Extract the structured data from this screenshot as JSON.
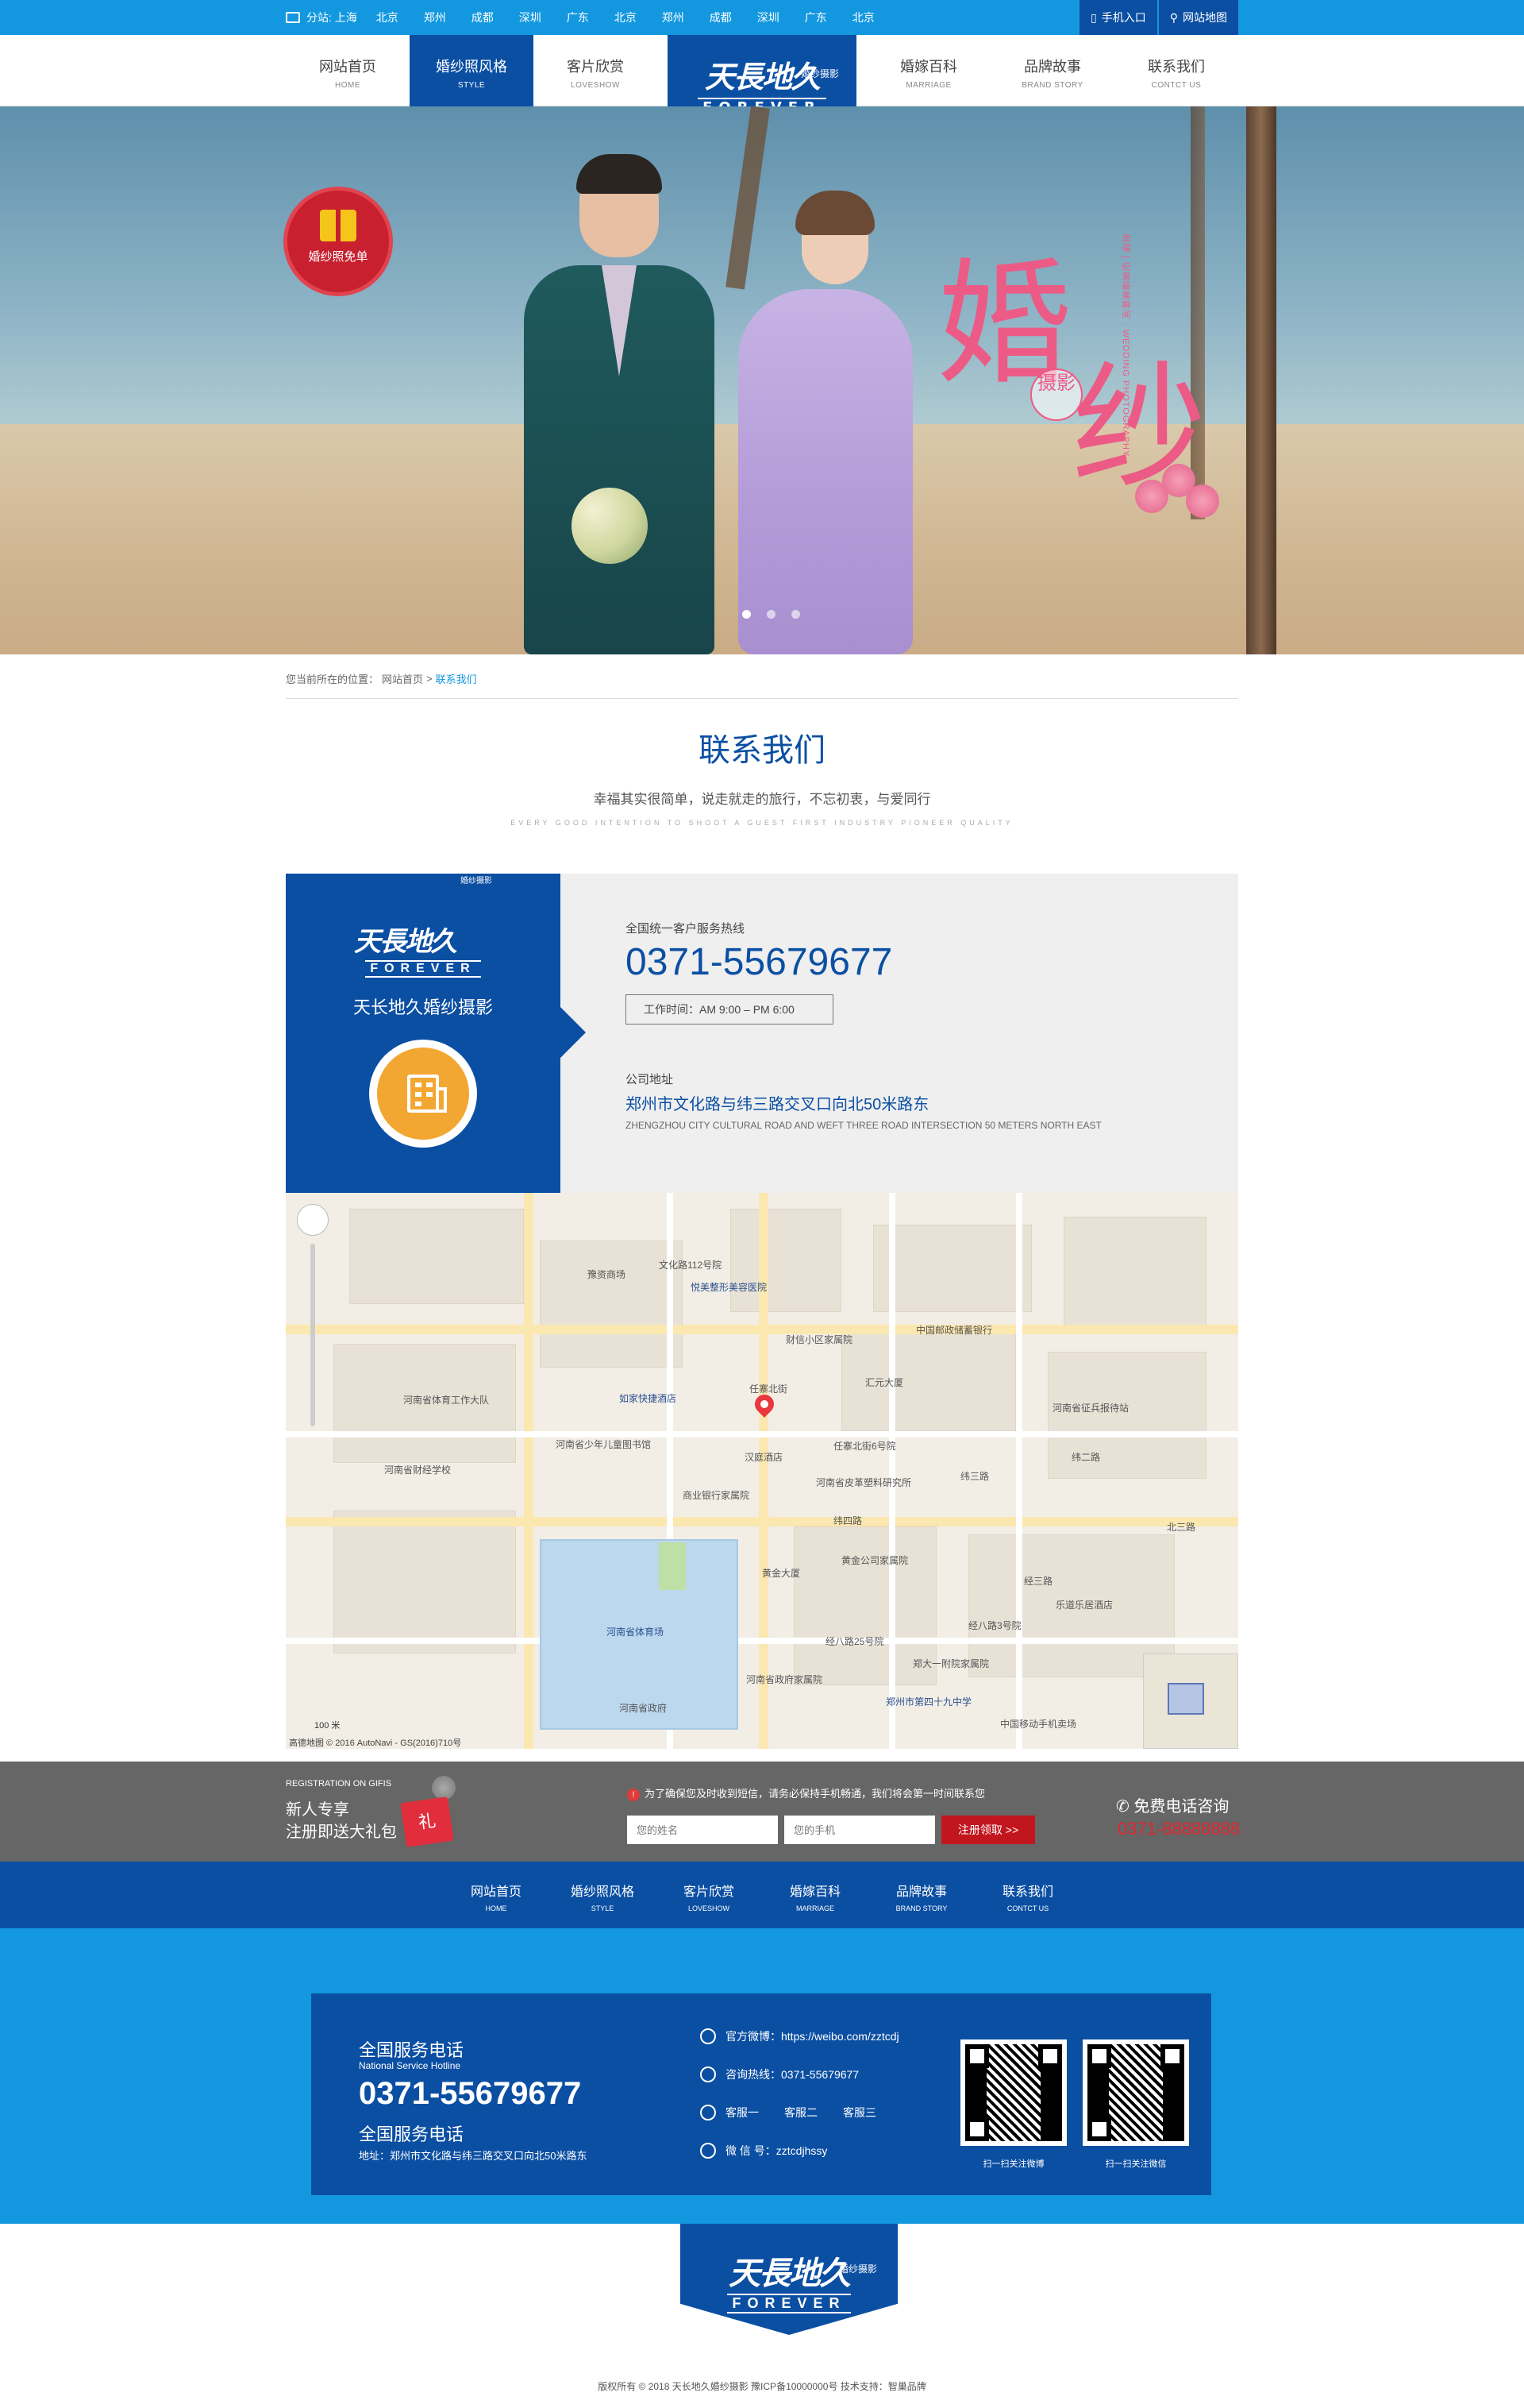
{
  "topbar": {
    "location_label": "分站: 上海",
    "cities": [
      "北京",
      "郑州",
      "成都",
      "深圳",
      "广东",
      "北京",
      "郑州",
      "成都",
      "深圳",
      "广东",
      "北京"
    ],
    "mobile_label": "手机入口",
    "sitemap_label": "网站地图"
  },
  "nav": {
    "items": [
      {
        "cn": "网站首页",
        "en": "HOME"
      },
      {
        "cn": "婚纱照风格",
        "en": "STYLE"
      },
      {
        "cn": "客片欣赏",
        "en": "LOVESHOW"
      },
      {
        "cn": "婚嫁百科",
        "en": "MARRIAGE"
      },
      {
        "cn": "品牌故事",
        "en": "BRAND STORY"
      },
      {
        "cn": "联系我们",
        "en": "CONTCT US"
      }
    ],
    "logo": {
      "brand": "天長地久",
      "sub": "婚纱摄影",
      "en": "FOREVER"
    }
  },
  "banner": {
    "badge_text": "婚纱照免单",
    "title_1": "婚",
    "title_2": "纱",
    "seal_text": "摄影",
    "vertical_text": "幸福 | 纪录最美瞬间 · WEDDING PHOTOGRAPHY",
    "slide_count": 3,
    "active_slide": 1
  },
  "breadcrumb": {
    "prefix": "您当前所在的位置：",
    "home": "网站首页",
    "sep": ">",
    "current": "联系我们"
  },
  "section": {
    "title": "联系我们",
    "subtitle": "幸福其实很简单，说走就走的旅行，不忘初衷，与爱同行",
    "subtitle_en": "EVERY GOOD INTENTION TO SHOOT A GUEST FIRST INDUSTRY PIONEER QUALITY"
  },
  "contact": {
    "brand": "天長地久",
    "brand_sub": "婚纱摄影",
    "brand_en": "FOREVER",
    "company": "天长地久婚纱摄影",
    "hotline_label": "全国统一客户服务热线",
    "phone": "0371-55679677",
    "hours": "工作时间：AM  9:00 – PM  6:00",
    "address_label": "公司地址",
    "address": "郑州市文化路与纬三路交叉口向北50米路东",
    "address_en": "ZHENGZHOU CITY CULTURAL ROAD AND WEFT THREE ROAD INTERSECTION 50 METERS NORTH EAST"
  },
  "map": {
    "labels": [
      "文化路112号院",
      "豫资商场",
      "悦美整形美容医院",
      "中国邮政储蓄银行",
      "财信小区家属院",
      "汇元大厦",
      "如家快捷酒店",
      "任寨北街",
      "汉庭酒店",
      "河南省体育工作大队",
      "河南省少年儿童图书馆",
      "河南省财经学校",
      "商业银行家属院",
      "河南省皮革塑料研究所",
      "纬三路",
      "任寨北街6号院",
      "黄金大厦",
      "黄金公司家属院",
      "经三路",
      "纬四路",
      "河南省体育场",
      "河南省政府",
      "经八路3号院",
      "经八路25号院",
      "郑大一附院家属院",
      "郑州市第四十九中学",
      "河南省政府家属院",
      "中国移动手机卖场",
      "乐道乐居酒店",
      "河南省征兵报待站",
      "纬二路",
      "北三路"
    ],
    "scale": "100 米",
    "attribution": "高德地图 © 2016 AutoNavi - GS(2016)710号"
  },
  "registration": {
    "en": "REGISTRATION ON GIFIS",
    "line1": "新人专享",
    "line2": "注册即送大礼包",
    "gift_char": "礼",
    "notice": "为了确保您及时收到短信，请务必保持手机畅通，我们将会第一时间联系您",
    "name_placeholder": "您的姓名",
    "phone_placeholder": "您的手机",
    "submit": "注册领取 >>",
    "call_title": "免费电话咨询",
    "call_number": "0371-88888888"
  },
  "footer_nav": [
    {
      "cn": "网站首页",
      "en": "HOME"
    },
    {
      "cn": "婚纱照风格",
      "en": "STYLE"
    },
    {
      "cn": "客片欣赏",
      "en": "LOVESHOW"
    },
    {
      "cn": "婚嫁百科",
      "en": "MARRIAGE"
    },
    {
      "cn": "品牌故事",
      "en": "BRAND STORY"
    },
    {
      "cn": "联系我们",
      "en": "CONTCT US"
    }
  ],
  "footer": {
    "hotline_title": "全国服务电话",
    "hotline_en": "National Service Hotline",
    "hotline_number": "0371-55679677",
    "service_title": "全国服务电话",
    "address": "地址：郑州市文化路与纬三路交叉口向北50米路东",
    "weibo": "官方微博：https://weibo.com/zztcdj",
    "consult": "咨询热线：0371-55679677",
    "qq_label": "客服一",
    "qq_2": "客服二",
    "qq_3": "客服三",
    "wechat": "微 信 号：zztcdjhssy",
    "qr1_caption": "扫一扫关注微博",
    "qr2_caption": "扫一扫关注微信"
  },
  "bottom": {
    "brand": "天長地久",
    "sub": "婚纱摄影",
    "en": "FOREVER",
    "copyright": "版权所有 © 2018 天长地久婚纱摄影  豫ICP备10000000号  技术支持：智巢品牌"
  }
}
